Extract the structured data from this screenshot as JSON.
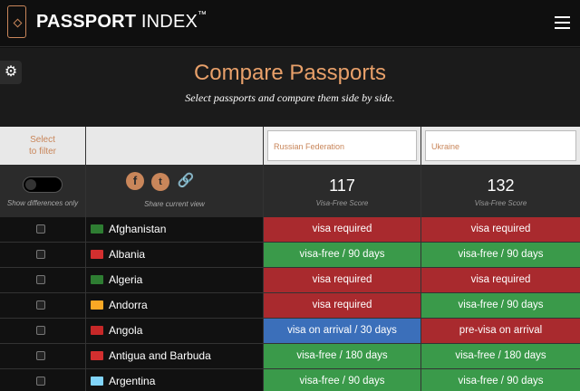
{
  "header": {
    "brand_strong": "PASSPORT",
    "brand_rest": " INDEX",
    "brand_tm": "™"
  },
  "hero": {
    "title": "Compare Passports",
    "subtitle": "Select passports and compare them side by side."
  },
  "controls": {
    "filter_label_line1": "Select",
    "filter_label_line2": "to filter",
    "show_differences_label": "Show differences only",
    "share_label": "Share current view",
    "icons": {
      "settings": "gear-icon",
      "facebook": "facebook-icon",
      "twitter": "twitter-icon",
      "link": "link-icon"
    }
  },
  "passports": [
    {
      "name": "Russian Federation",
      "score": "117",
      "score_label": "Visa-Free Score"
    },
    {
      "name": "Ukraine",
      "score": "132",
      "score_label": "Visa-Free Score"
    }
  ],
  "status_colors": {
    "visa_required": "#a92a2e",
    "visa_free": "#3a9a4a",
    "visa_on_arrival": "#3b6fba",
    "pre_visa": "#a92a2e"
  },
  "rows": [
    {
      "country": "Afghanistan",
      "flag_color": "#2e7d32",
      "a": "visa required",
      "a_status": "red",
      "b": "visa required",
      "b_status": "red"
    },
    {
      "country": "Albania",
      "flag_color": "#d32f2f",
      "a": "visa-free / 90 days",
      "a_status": "green",
      "b": "visa-free / 90 days",
      "b_status": "green"
    },
    {
      "country": "Algeria",
      "flag_color": "#2e7d32",
      "a": "visa required",
      "a_status": "red",
      "b": "visa required",
      "b_status": "red"
    },
    {
      "country": "Andorra",
      "flag_color": "#f9a825",
      "a": "visa required",
      "a_status": "red",
      "b": "visa-free / 90 days",
      "b_status": "green"
    },
    {
      "country": "Angola",
      "flag_color": "#c62828",
      "a": "visa on arrival / 30 days",
      "a_status": "blue",
      "b": "pre-visa on arrival",
      "b_status": "red"
    },
    {
      "country": "Antigua and Barbuda",
      "flag_color": "#d32f2f",
      "a": "visa-free / 180 days",
      "a_status": "green",
      "b": "visa-free / 180 days",
      "b_status": "green"
    },
    {
      "country": "Argentina",
      "flag_color": "#81d4fa",
      "a": "visa-free / 90 days",
      "a_status": "green",
      "b": "visa-free / 90 days",
      "b_status": "green"
    }
  ]
}
